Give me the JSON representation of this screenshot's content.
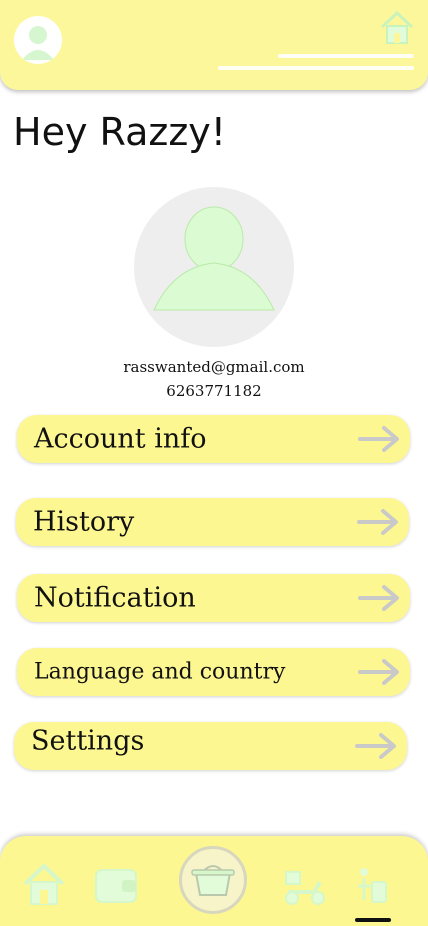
{
  "greeting": "Hey Razzy!",
  "profile": {
    "email": "rasswanted@gmail.com",
    "phone": "6263771182"
  },
  "menu": [
    {
      "label": "Account info",
      "icon": "arrow-right-icon"
    },
    {
      "label": "History",
      "icon": "arrow-right-icon"
    },
    {
      "label": "Notification",
      "icon": "arrow-right-icon"
    },
    {
      "label": "Language and country",
      "icon": "arrow-right-icon"
    },
    {
      "label": "Settings",
      "icon": "arrow-right-icon"
    }
  ],
  "bottom_nav": [
    {
      "icon": "home-icon"
    },
    {
      "icon": "wallet-icon"
    },
    {
      "icon": "cart-icon"
    },
    {
      "icon": "delivery-scooter-icon"
    },
    {
      "icon": "person-luggage-icon"
    }
  ],
  "colors": {
    "bar_yellow": "#fdf79b",
    "item_yellow": "#fdf792",
    "icon_green": "#dffbd6",
    "arrow_grey": "#c9c9c9"
  }
}
